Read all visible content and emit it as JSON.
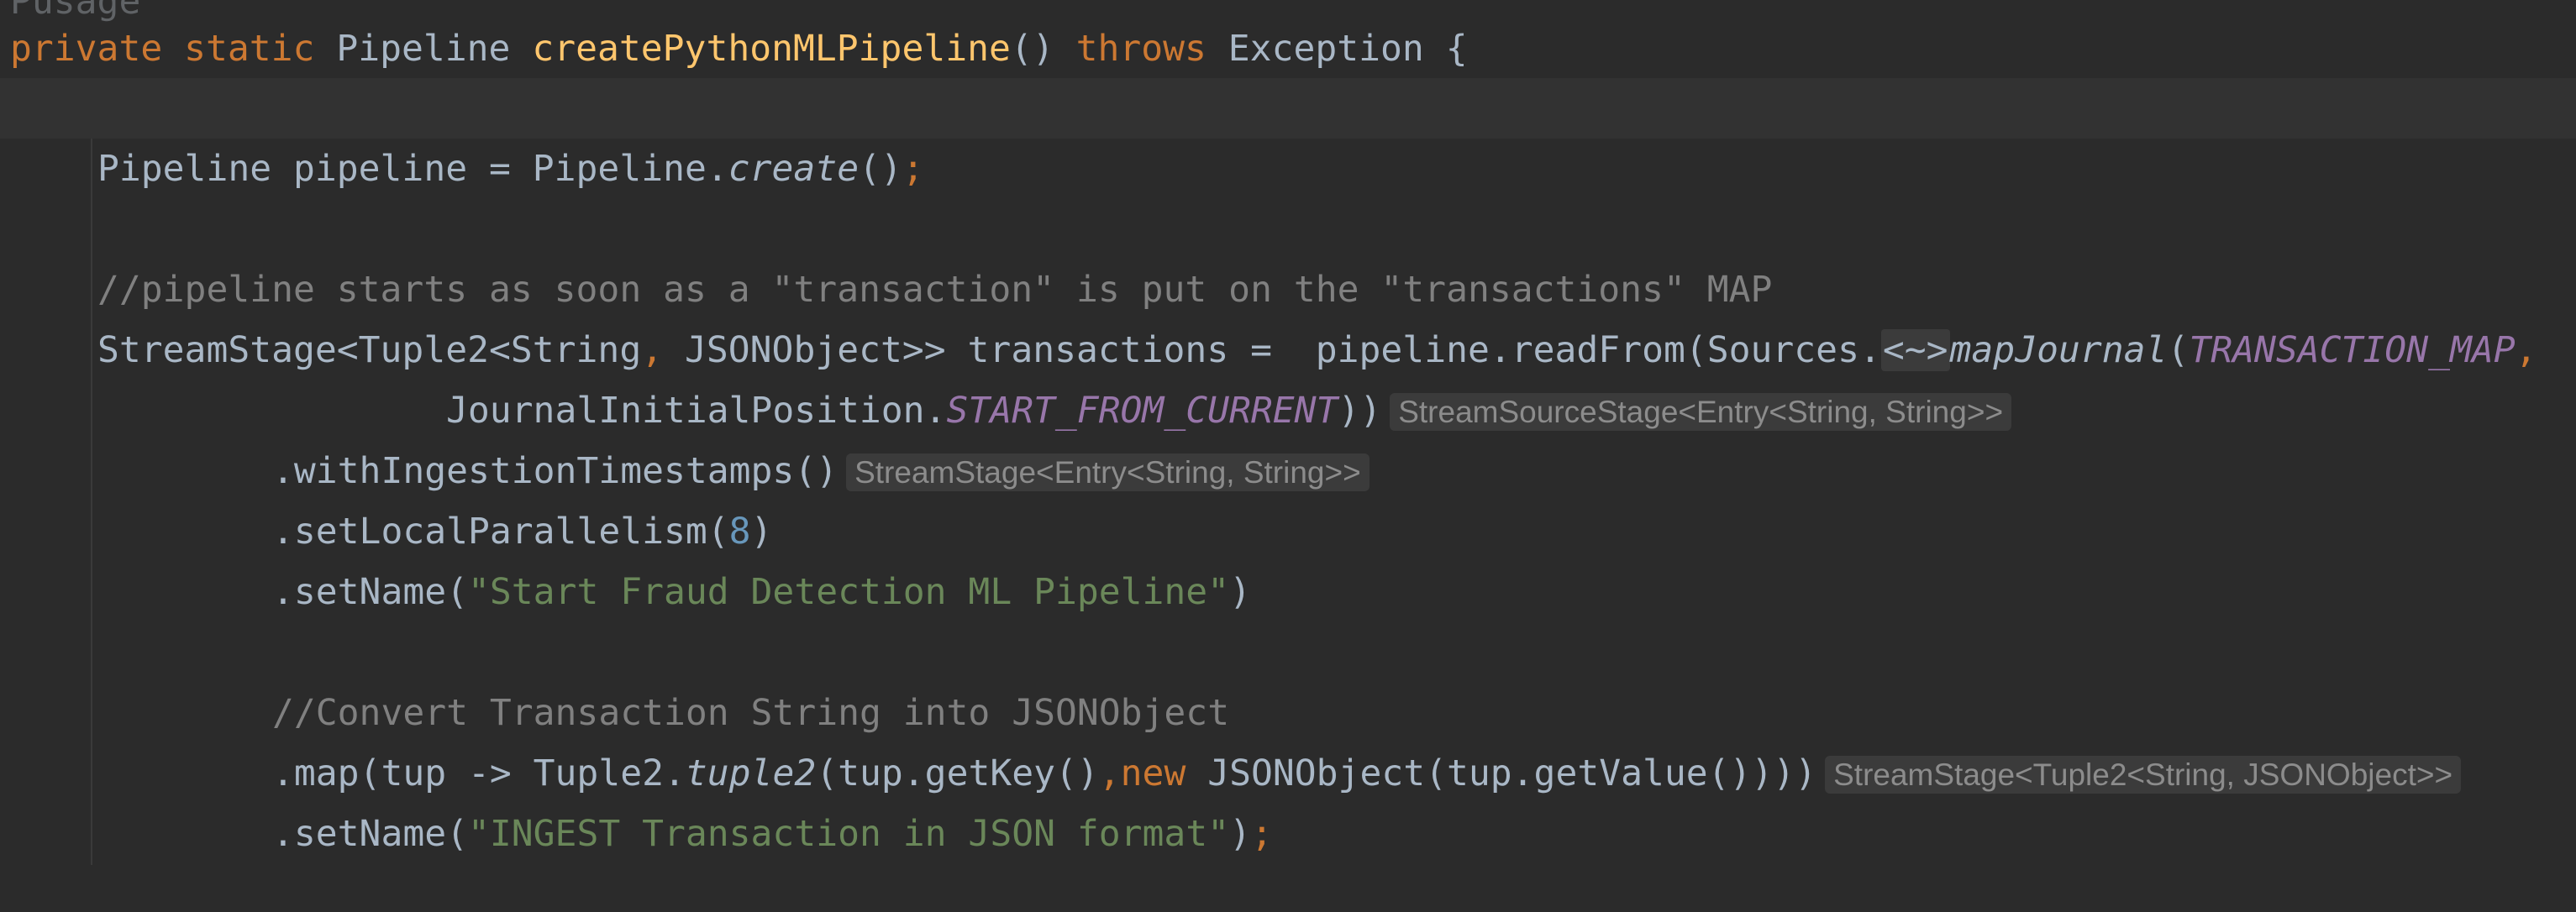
{
  "header_fragment": "Pusage",
  "signature": {
    "kw_private": "private",
    "kw_static": "static",
    "return_type": "Pipeline",
    "method_name": "createPythonMLPipeline",
    "parens": "()",
    "kw_throws": "throws",
    "exception": "Exception",
    "open_brace": "{"
  },
  "line_pipeline": {
    "decl": "Pipeline pipeline = Pipeline.",
    "call": "create",
    "end": "()",
    "semi": ";"
  },
  "comment1": "//pipeline starts as soon as a \"transaction\" is put on the \"transactions\" MAP",
  "line_stream": {
    "decl_a": "StreamStage<Tuple2<String",
    "comma": ",",
    "decl_b": " JSONObject>> transactions =  pipeline.readFrom(Sources.",
    "fold": "<~>",
    "method": "mapJournal",
    "paren": "(",
    "const": "TRANSACTION_MAP",
    "comma2": ","
  },
  "line_initial": {
    "prefix": "JournalInitialPosition.",
    "const": "START_FROM_CURRENT",
    "suffix": "))",
    "hint": "StreamSourceStage<Entry<String, String>>"
  },
  "line_ingest": {
    "code": ".withIngestionTimestamps()",
    "hint": "StreamStage<Entry<String, String>>"
  },
  "line_parallel": {
    "code": ".setLocalParallelism(",
    "num": "8",
    "close": ")"
  },
  "line_setname1": {
    "code": ".setName(",
    "str": "\"Start Fraud Detection ML Pipeline\"",
    "close": ")"
  },
  "comment2": "//Convert Transaction String into JSONObject",
  "line_map": {
    "code_a": ".map(tup -> Tuple2.",
    "method": "tuple2",
    "code_b": "(tup.getKey()",
    "comma": ",",
    "kw_new": "new",
    "code_c": " JSONObject(tup.getValue()))",
    "close": ")",
    "hint": "StreamStage<Tuple2<String, JSONObject>>"
  },
  "line_setname2": {
    "code": ".setName(",
    "str": "\"INGEST Transaction in JSON format\"",
    "close": ")",
    "semi": ";"
  },
  "colors": {
    "background": "#2b2b2b",
    "current_line": "#323232",
    "keyword": "#cc7832",
    "method_decl": "#ffc66d",
    "constant": "#9876aa",
    "number": "#6897bb",
    "string": "#6a8759",
    "comment": "#808080",
    "default": "#a9b7c6"
  }
}
